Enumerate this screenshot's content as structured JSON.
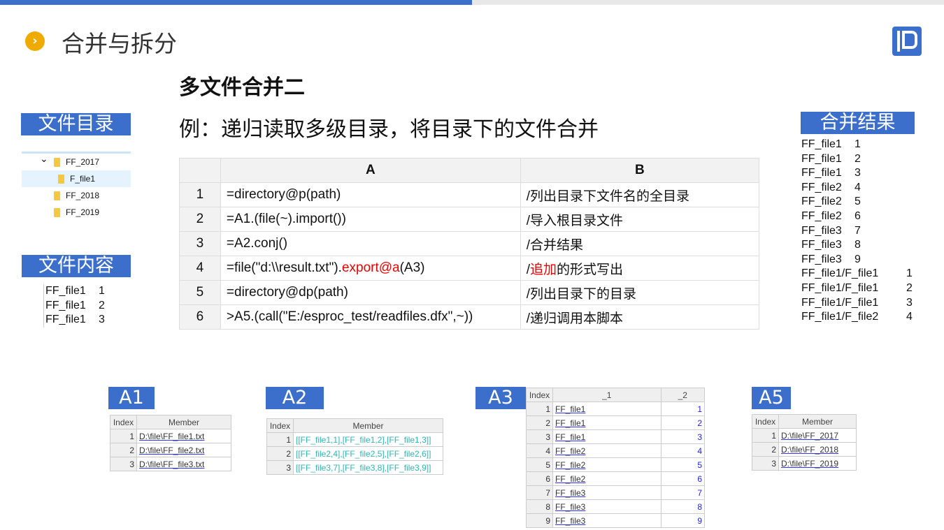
{
  "header": {
    "title": "合并与拆分",
    "bullet_icon": "chevron-right-icon",
    "accent": "#3c6fcc"
  },
  "subtitle": "多文件合并二",
  "example": "例：递归读取多级目录，将目录下的文件合并",
  "dir": {
    "label": "文件目录",
    "items": [
      {
        "name": "FF_2017",
        "expanded": true,
        "level": 0
      },
      {
        "name": "F_file1",
        "level": 1,
        "selected": true
      },
      {
        "name": "FF_2018",
        "level": 0
      },
      {
        "name": "FF_2019",
        "level": 0
      }
    ]
  },
  "content": {
    "label": "文件内容",
    "rows": [
      [
        "FF_file1",
        "1"
      ],
      [
        "FF_file1",
        "2"
      ],
      [
        "FF_file1",
        "3"
      ]
    ]
  },
  "merge": {
    "label": "合并结果",
    "rows": [
      [
        "FF_file1",
        "1"
      ],
      [
        "FF_file1",
        "2"
      ],
      [
        "FF_file1",
        "3"
      ],
      [
        "FF_file2",
        "4"
      ],
      [
        "FF_file2",
        "5"
      ],
      [
        "FF_file2",
        "6"
      ],
      [
        "FF_file3",
        "7"
      ],
      [
        "FF_file3",
        "8"
      ],
      [
        "FF_file3",
        "9"
      ],
      [
        "FF_file1/F_file1",
        "1"
      ],
      [
        "FF_file1/F_file1",
        "2"
      ],
      [
        "FF_file1/F_file1",
        "3"
      ],
      [
        "FF_file1/F_file2",
        "4"
      ]
    ]
  },
  "code": {
    "headers": [
      "A",
      "B"
    ],
    "rows": [
      {
        "n": "1",
        "a": "=directory@p(path)",
        "b": "/列出目录下文件名的全目录"
      },
      {
        "n": "2",
        "a": "=A1.(file(~).import())",
        "b": "/导入根目录文件"
      },
      {
        "n": "3",
        "a": "=A2.conj()",
        "b": "/合并结果"
      },
      {
        "n": "4",
        "a": "=file(\"d:\\\\result.txt\").",
        "a_red": "export@a",
        "a_tail": "(A3)",
        "b": "/",
        "b_red": "追加",
        "b_tail": "的形式写出"
      },
      {
        "n": "5",
        "a": "=directory@dp(path)",
        "b": "/列出目录下的目录"
      },
      {
        "n": "6",
        "a": ">A5.(call(\"E:/esproc_test/readfiles.dfx\",~))",
        "b": "/递归调用本脚本"
      }
    ]
  },
  "results": {
    "A1": {
      "label": "A1",
      "headers": [
        "Index",
        "Member"
      ],
      "rows": [
        [
          "1",
          "D:\\file\\FF_file1.txt"
        ],
        [
          "2",
          "D:\\file\\FF_file2.txt"
        ],
        [
          "3",
          "D:\\file\\FF_file3.txt"
        ]
      ]
    },
    "A2": {
      "label": "A2",
      "headers": [
        "Index",
        "Member"
      ],
      "rows": [
        [
          "1",
          "[[FF_file1,1],[FF_file1,2],[FF_file1,3]]"
        ],
        [
          "2",
          "[[FF_file2,4],[FF_file2,5],[FF_file2,6]]"
        ],
        [
          "3",
          "[[FF_file3,7],[FF_file3,8],[FF_file3,9]]"
        ]
      ]
    },
    "A3": {
      "label": "A3",
      "headers": [
        "Index",
        "_1",
        "_2"
      ],
      "rows": [
        [
          "1",
          "FF_file1",
          "1"
        ],
        [
          "2",
          "FF_file1",
          "2"
        ],
        [
          "3",
          "FF_file1",
          "3"
        ],
        [
          "4",
          "FF_file2",
          "4"
        ],
        [
          "5",
          "FF_file2",
          "5"
        ],
        [
          "6",
          "FF_file2",
          "6"
        ],
        [
          "7",
          "FF_file3",
          "7"
        ],
        [
          "8",
          "FF_file3",
          "8"
        ],
        [
          "9",
          "FF_file3",
          "9"
        ]
      ]
    },
    "A5": {
      "label": "A5",
      "headers": [
        "Index",
        "Member"
      ],
      "rows": [
        [
          "1",
          "D:\\file\\FF_2017"
        ],
        [
          "2",
          "D:\\file\\FF_2018"
        ],
        [
          "3",
          "D:\\file\\FF_2019"
        ]
      ]
    }
  }
}
